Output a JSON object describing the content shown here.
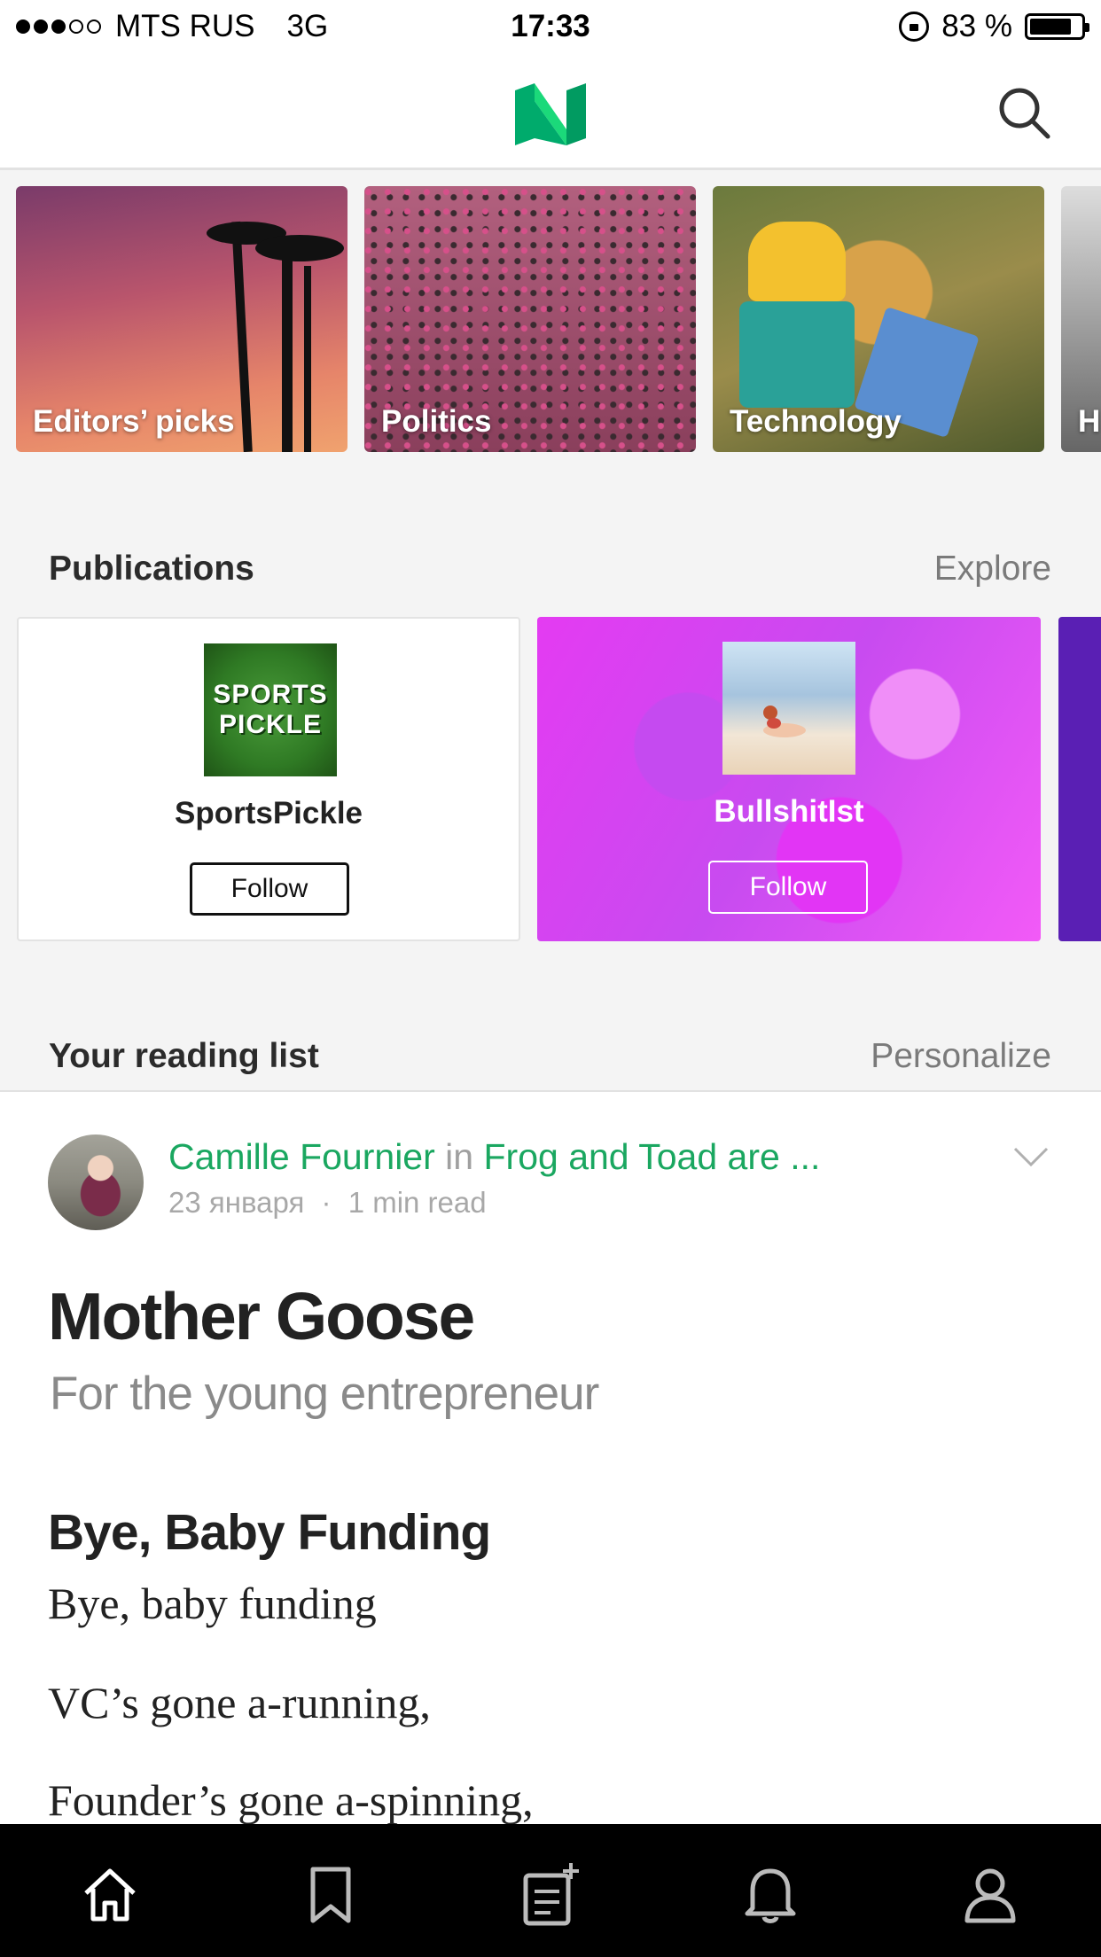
{
  "status_bar": {
    "signal_dots_filled": 3,
    "signal_dots_total": 5,
    "carrier": "MTS RUS",
    "network": "3G",
    "time": "17:33",
    "battery": "83 %",
    "battery_level": 0.83
  },
  "header": {
    "logo_icon": "medium-logo-icon",
    "search_icon": "search-icon",
    "accent": "#00ab6c"
  },
  "topics": [
    {
      "label": "Editors’ picks"
    },
    {
      "label": "Politics"
    },
    {
      "label": "Technology"
    },
    {
      "label": "H"
    }
  ],
  "publications_section": {
    "title": "Publications",
    "link": "Explore",
    "items": [
      {
        "name": "SportsPickle",
        "logo_text_1": "SPORTS",
        "logo_text_2": "PICKLE",
        "follow": "Follow"
      },
      {
        "name": "BullshitIst",
        "follow": "Follow"
      }
    ]
  },
  "reading_list": {
    "title": "Your reading list",
    "link": "Personalize"
  },
  "article": {
    "author": "Camille Fournier",
    "in": "in",
    "publication": "Frog and Toad are ...",
    "date": "23 января",
    "separator": "·",
    "read_time": "1 min read",
    "title": "Mother Goose",
    "subtitle": "For the young entrepreneur",
    "heading": "Bye, Baby Funding",
    "lines": [
      "Bye, baby funding",
      "VC’s gone a-running,",
      "Founder’s gone a-spinning,"
    ]
  },
  "bottom_nav": {
    "items": [
      "home-icon",
      "bookmark-icon",
      "write-story-icon",
      "notifications-icon",
      "profile-icon"
    ]
  }
}
